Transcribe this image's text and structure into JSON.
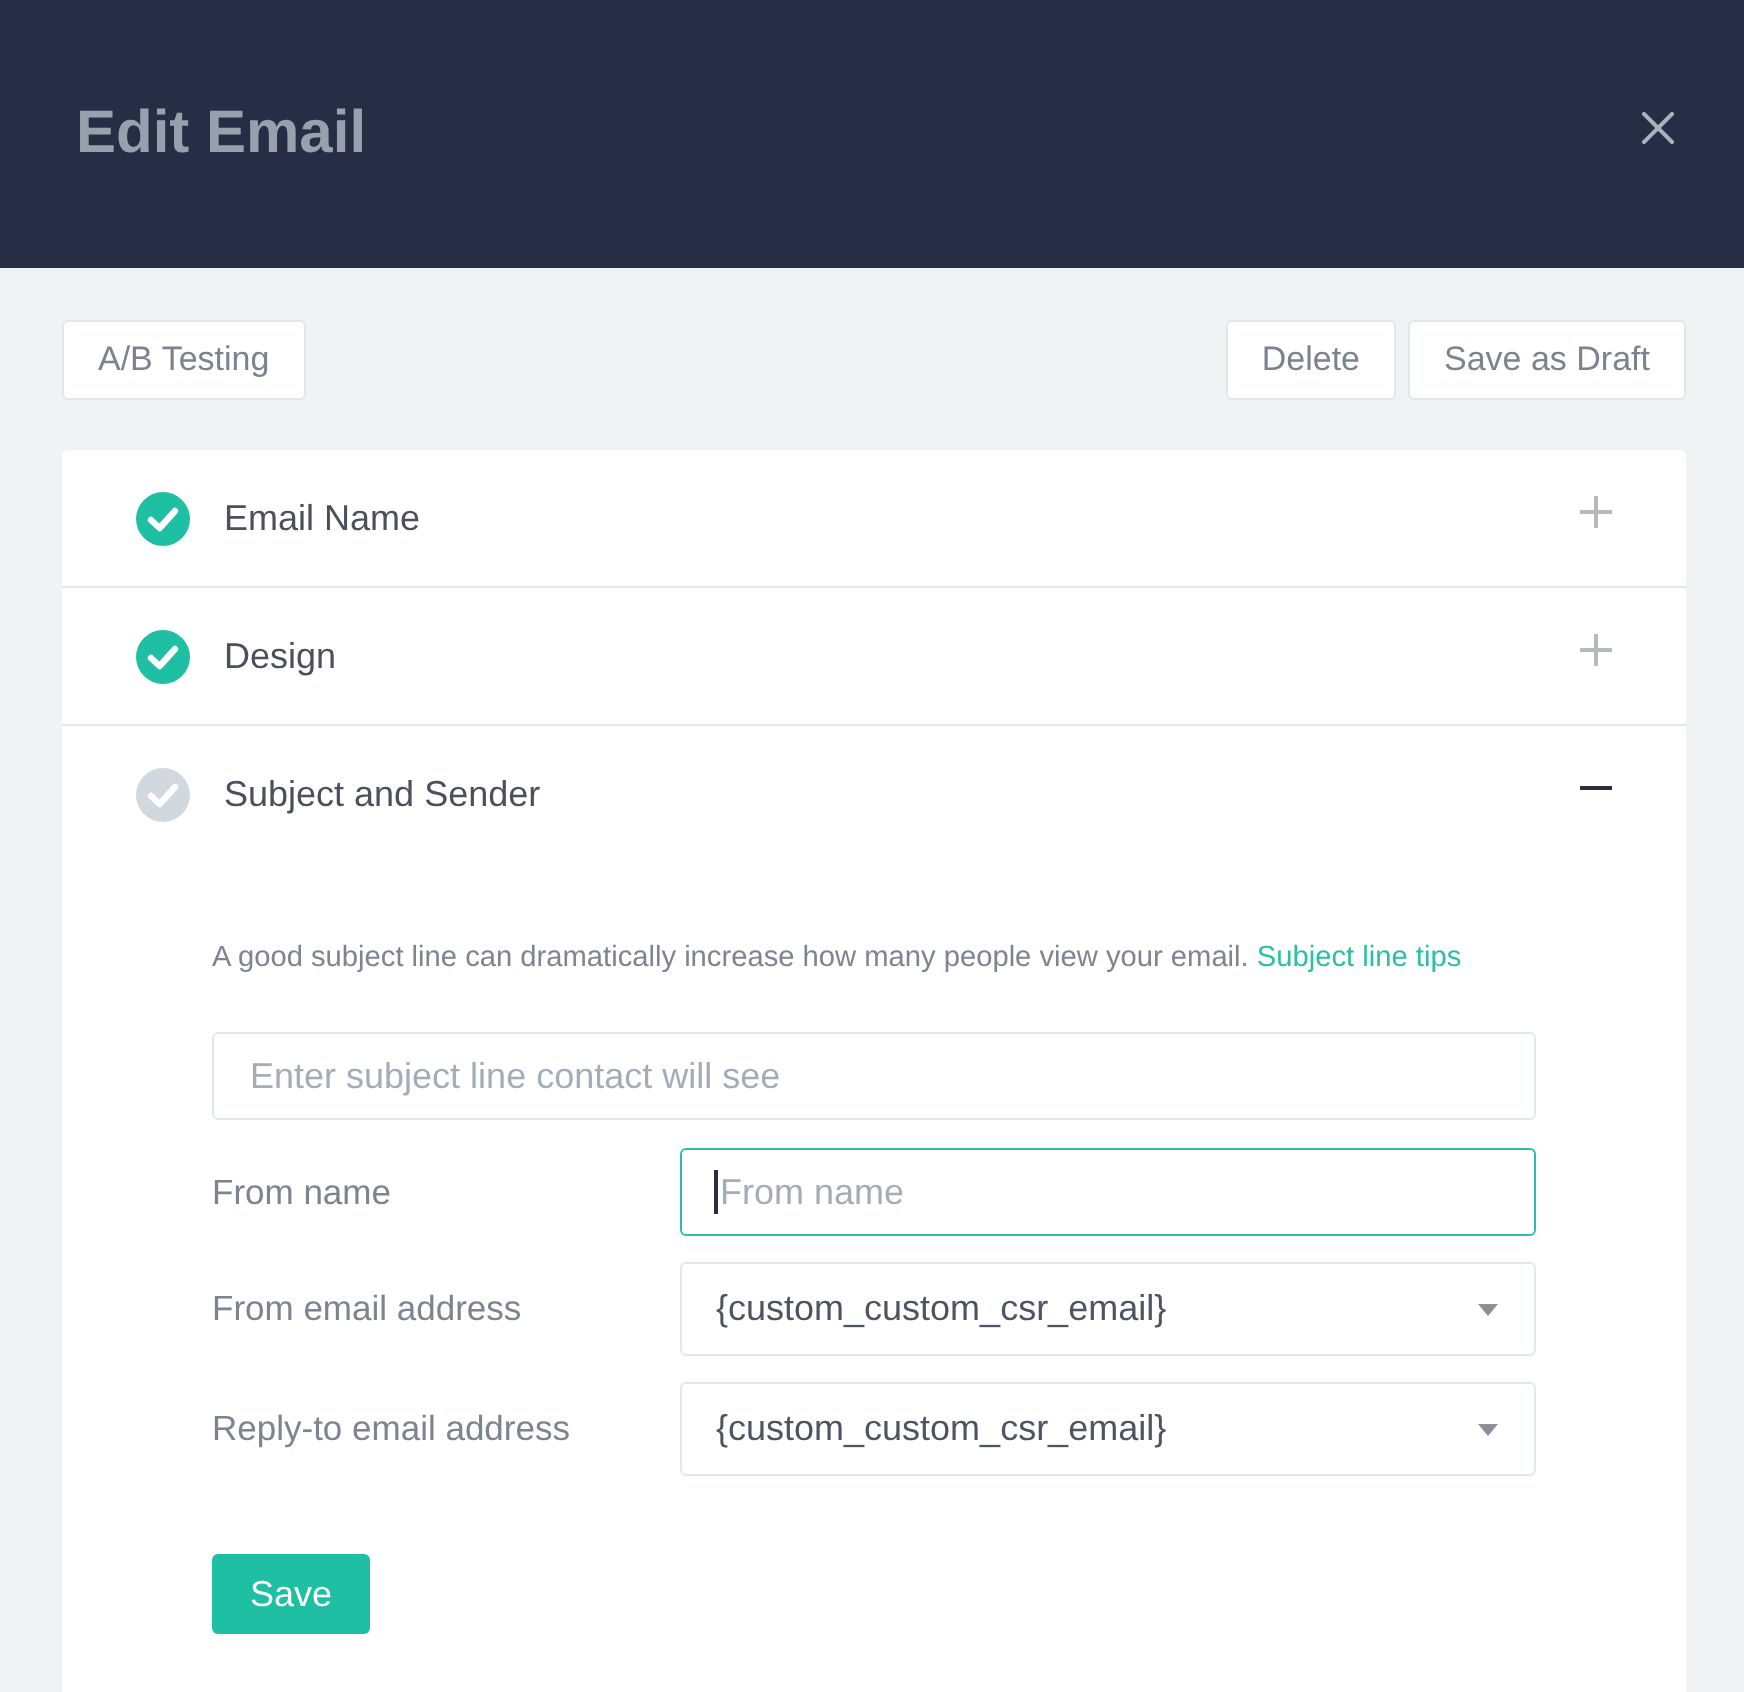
{
  "header": {
    "title": "Edit Email"
  },
  "toolbar": {
    "left_buttons": [
      "A/B Testing"
    ],
    "right_buttons": [
      "Delete",
      "Save as Draft"
    ]
  },
  "sections": [
    {
      "title": "Email Name",
      "completed": true,
      "expanded": false
    },
    {
      "title": "Design",
      "completed": true,
      "expanded": false
    },
    {
      "title": "Subject and Sender",
      "completed": false,
      "expanded": true,
      "content": {
        "hint": {
          "text": "A good subject line can dramatically increase how many people view your email.",
          "link": "Subject line tips"
        },
        "subject": {
          "placeholder": "Enter subject line contact will see",
          "focused": false
        },
        "fields": [
          {
            "kind": "text",
            "label": "From name",
            "placeholder": "From name",
            "focused": true
          },
          {
            "kind": "select",
            "label": "From email address",
            "value": "{custom_custom_csr_email}"
          },
          {
            "kind": "select",
            "label": "Reply-to email address",
            "value": "{custom_custom_csr_email}"
          }
        ],
        "save_button": "Save"
      }
    }
  ]
}
